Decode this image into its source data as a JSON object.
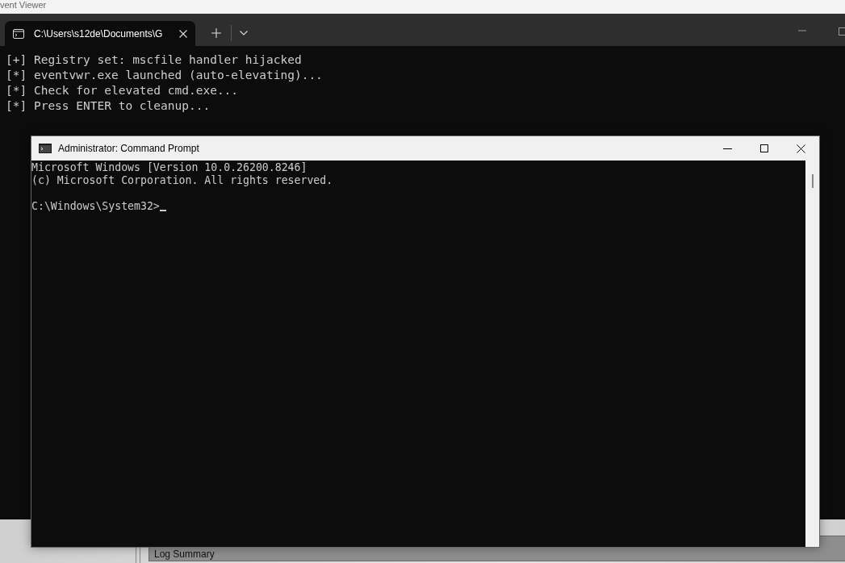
{
  "background_window": {
    "title": "vent Viewer",
    "panel_heading": "Log Summary"
  },
  "terminal": {
    "tabs": [
      {
        "label": "C:\\Users\\s12de\\Documents\\G",
        "selected": true
      }
    ],
    "lines": [
      "[+] Registry set: mscfile handler hijacked",
      "[*] eventvwr.exe launched (auto-elevating)...",
      "[*] Check for elevated cmd.exe...",
      "[*] Press ENTER to cleanup..."
    ]
  },
  "cmd_window": {
    "title": "Administrator: Command Prompt",
    "lines": [
      "Microsoft Windows [Version 10.0.26200.8246]",
      "(c) Microsoft Corporation. All rights reserved."
    ],
    "prompt": "C:\\Windows\\System32>"
  }
}
